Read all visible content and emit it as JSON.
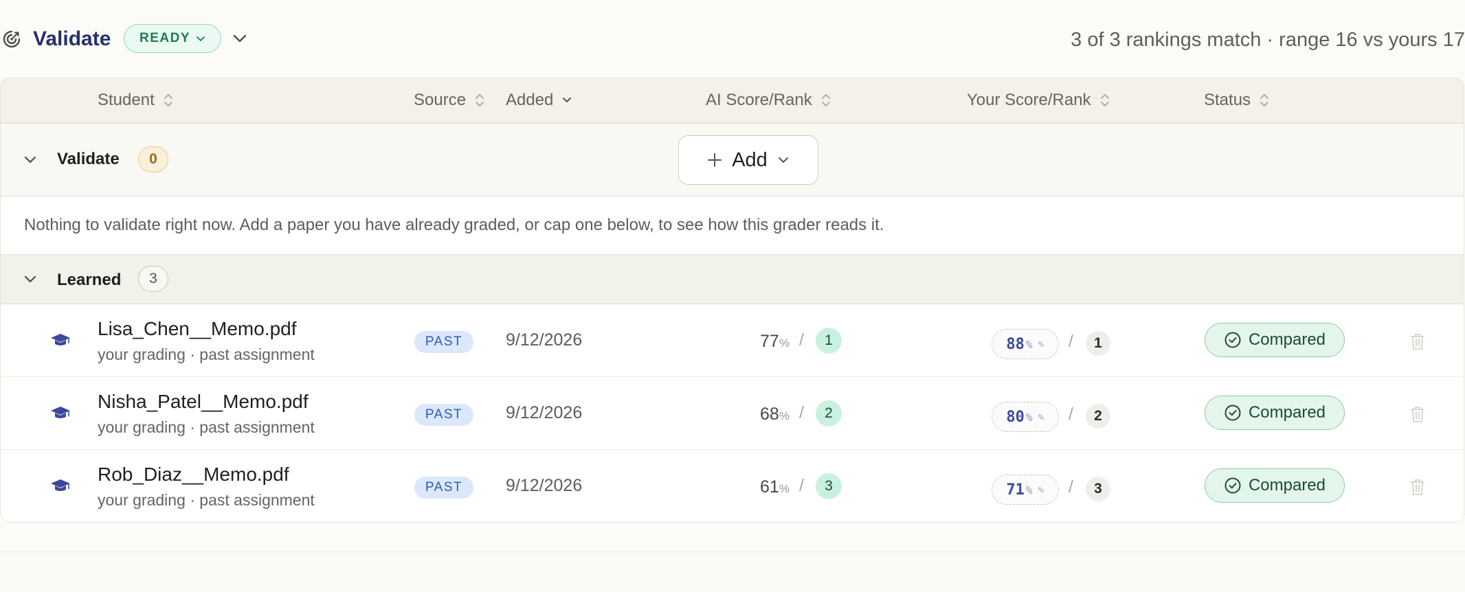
{
  "app": {
    "title": "Validate",
    "status_badge": "READY",
    "summary": "3 of 3 rankings match · range 16 vs yours 17"
  },
  "table": {
    "columns": {
      "student": "Student",
      "source": "Source",
      "added": "Added",
      "ai_score": "AI Score/Rank",
      "your_score": "Your Score/Rank",
      "status": "Status"
    },
    "validate_group": {
      "label": "Validate",
      "count": "0",
      "add_label": "Add",
      "empty_message": "Nothing to validate right now. Add a paper you have already graded, or cap one below, to see how this grader reads it."
    },
    "learned_group": {
      "label": "Learned",
      "count": "3"
    },
    "rows": [
      {
        "file": "Lisa_Chen__Memo.pdf",
        "subtitle": "your grading · past assignment",
        "source": "PAST",
        "added": "9/12/2026",
        "ai_score": "77",
        "ai_rank": "1",
        "your_score": "88",
        "your_rank": "1",
        "status": "Compared"
      },
      {
        "file": "Nisha_Patel__Memo.pdf",
        "subtitle": "your grading · past assignment",
        "source": "PAST",
        "added": "9/12/2026",
        "ai_score": "68",
        "ai_rank": "2",
        "your_score": "80",
        "your_rank": "2",
        "status": "Compared"
      },
      {
        "file": "Rob_Diaz__Memo.pdf",
        "subtitle": "your grading · past assignment",
        "source": "PAST",
        "added": "9/12/2026",
        "ai_score": "61",
        "ai_rank": "3",
        "your_score": "71",
        "your_rank": "3",
        "status": "Compared"
      }
    ],
    "percent_sign": "%",
    "slash": "/",
    "pencil": "✎"
  },
  "icons": {
    "logo": "grader-logo-icon",
    "sort": "sort-icon",
    "chevron": "chevron-down-icon",
    "cap": "graduation-cap-icon",
    "check": "check-circle-icon",
    "trash": "trash-icon",
    "plus": "plus-icon"
  },
  "colors": {
    "accent": "#26306b",
    "ready": "#1e7a55",
    "source_badge": "#2c5ab4",
    "compared": "#1c4a36",
    "validate_count": "#9a6a16"
  }
}
